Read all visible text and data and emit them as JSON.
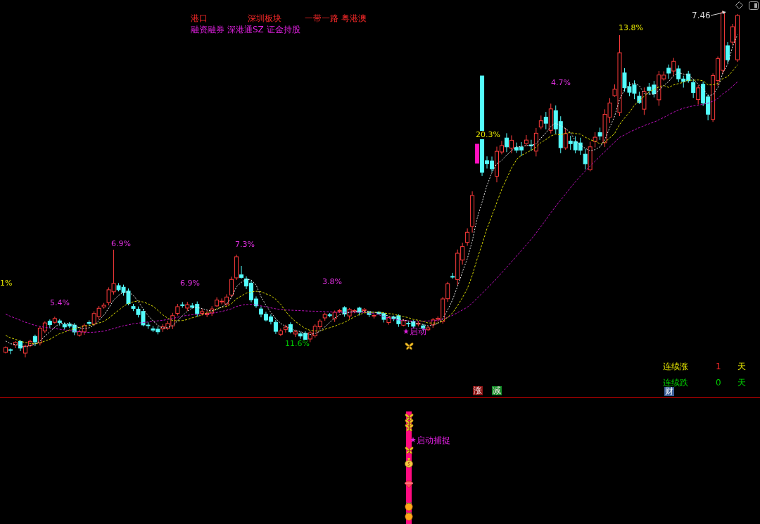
{
  "sector_tags": [
    "港口",
    "深圳板块",
    "一带一路",
    "粤港澳"
  ],
  "concept_tags": [
    "融资融券",
    "深港通SZ",
    "证金持股"
  ],
  "price_marker": "7.46",
  "percent_labels": [
    {
      "text": "1%",
      "color": "#e6e600"
    },
    {
      "text": "5.4%",
      "color": "#e030e0"
    },
    {
      "text": "6.9%",
      "color": "#e030e0"
    },
    {
      "text": "6.9%",
      "color": "#e030e0"
    },
    {
      "text": "7.3%",
      "color": "#e030e0"
    },
    {
      "text": "11.6%",
      "color": "#00c800"
    },
    {
      "text": "3.8%",
      "color": "#e030e0"
    },
    {
      "text": "20.3%",
      "color": "#e6e600"
    },
    {
      "text": "4.7%",
      "color": "#e030e0"
    },
    {
      "text": "13.8%",
      "color": "#e6e600"
    }
  ],
  "start_marker": {
    "label": "启动"
  },
  "signal_badges": [
    {
      "label": "涨",
      "color": "#8c1414"
    },
    {
      "label": "减",
      "color": "#148c28"
    }
  ],
  "streak_stats": [
    {
      "kind": "up",
      "label": "连续涨",
      "count": "1",
      "unit": "天"
    },
    {
      "kind": "down",
      "label": "连续跌",
      "count": "0",
      "unit": "天"
    }
  ],
  "finance_badge": "财",
  "signal_panel": {
    "label": "启动捕捉"
  }
}
